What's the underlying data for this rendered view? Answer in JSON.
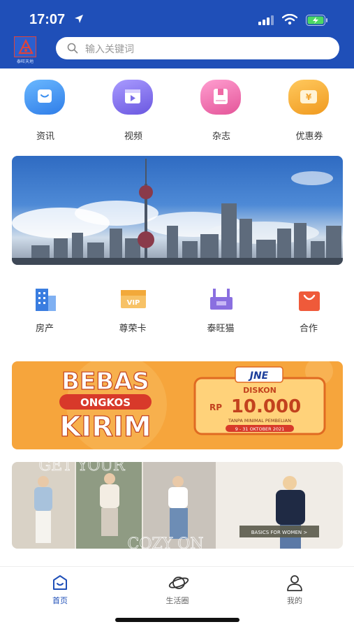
{
  "status_bar": {
    "time": "17:07"
  },
  "header": {
    "logo_icon": "app-logo",
    "logo_caption": "泰旺天地",
    "search": {
      "placeholder": "输入关键词",
      "icon": "search-icon"
    }
  },
  "categories": [
    {
      "label": "资讯",
      "icon": "message-icon",
      "color": "#3a8ff0"
    },
    {
      "label": "视频",
      "icon": "video-icon",
      "color": "#7b6ee8"
    },
    {
      "label": "杂志",
      "icon": "magazine-icon",
      "color": "#ef6aa5"
    },
    {
      "label": "优惠券",
      "icon": "coupon-icon",
      "color": "#f2a531"
    }
  ],
  "banner_city": {
    "subject": "city-skyline-photo"
  },
  "services": [
    {
      "label": "房产",
      "icon": "building-icon",
      "color": "#3a7de0"
    },
    {
      "label": "尊荣卡",
      "icon": "vip-card-icon",
      "color": "#f2b04a"
    },
    {
      "label": "泰旺猫",
      "icon": "shop-icon",
      "color": "#8a6fe0"
    },
    {
      "label": "合作",
      "icon": "bag-icon",
      "color": "#ef5a3a"
    }
  ],
  "promo_banner": {
    "line1": "BEBAS",
    "line2": "ONGKOS",
    "line3": "KIRIM",
    "brand": "JNE",
    "diskon": "DISKON",
    "currency": "RP",
    "amount": "10.000",
    "terms": "TANPA MINIMAL PEMBELIAN",
    "dates": "9 - 31 OKTOBER 2021"
  },
  "fashion_banner": {
    "overlay_top": "GET YOUR",
    "overlay_bottom": "COZY ON",
    "tag": "BASICS FOR WOMEN >"
  },
  "tab_bar": {
    "active_color": "#1f4fb8",
    "tabs": [
      {
        "label": "首页",
        "icon": "home-icon",
        "active": true
      },
      {
        "label": "生活圈",
        "icon": "planet-icon",
        "active": false
      },
      {
        "label": "我的",
        "icon": "user-icon",
        "active": false
      }
    ]
  }
}
